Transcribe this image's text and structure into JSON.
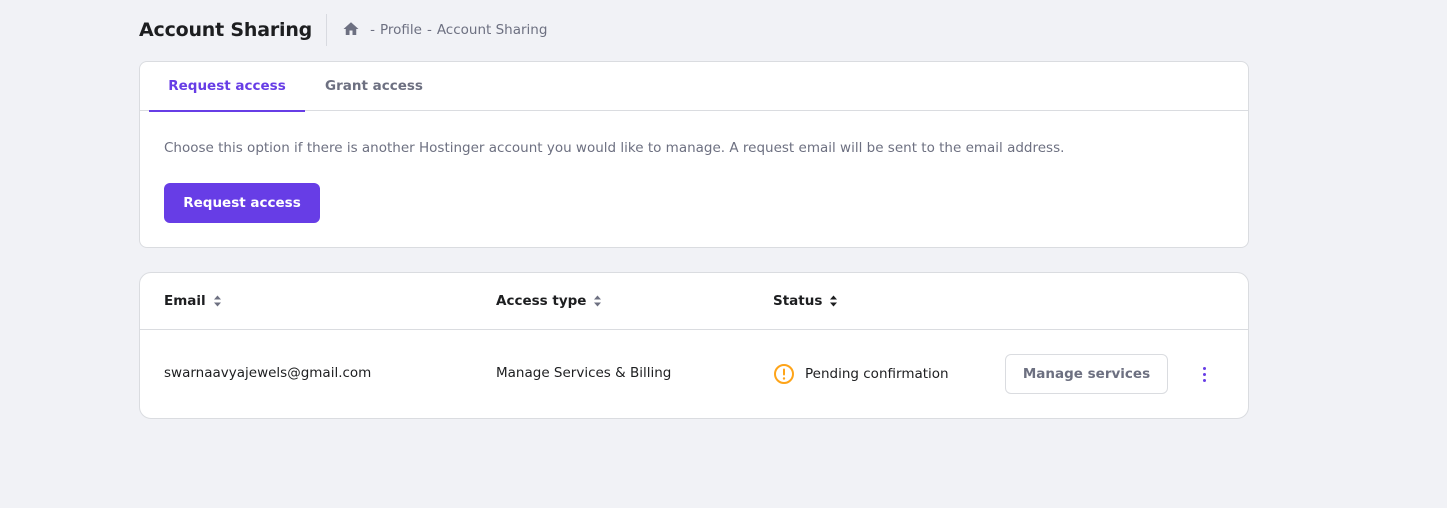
{
  "header": {
    "title": "Account Sharing",
    "breadcrumb": [
      "Profile",
      "Account Sharing"
    ],
    "separator": "-",
    "home_icon": "home-icon"
  },
  "tabs": {
    "items": [
      {
        "label": "Request access",
        "active": true
      },
      {
        "label": "Grant access",
        "active": false
      }
    ],
    "description": "Choose this option if there is another Hostinger account you would like to manage. A request email will be sent to the email address.",
    "button_label": "Request access"
  },
  "table": {
    "columns": [
      {
        "label": "Email",
        "sortable": true
      },
      {
        "label": "Access type",
        "sortable": true
      },
      {
        "label": "Status",
        "sortable": true
      }
    ],
    "rows": [
      {
        "email": "swarnaavyajewels@gmail.com",
        "access_type": "Manage Services & Billing",
        "status": "Pending confirmation",
        "status_icon": "warning-circle-icon",
        "action_label": "Manage services"
      }
    ]
  },
  "colors": {
    "accent": "#673de6",
    "warning": "#fea419",
    "background": "#f1f2f6",
    "muted_text": "#6d7081"
  }
}
